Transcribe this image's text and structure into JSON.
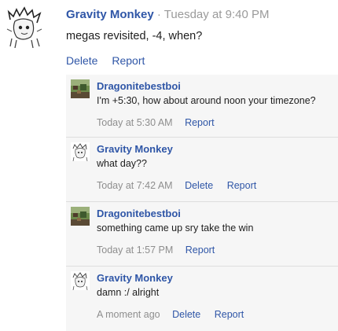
{
  "main_post": {
    "author": "Gravity Monkey",
    "separator": "·",
    "timestamp": "Tuesday at 9:40 PM",
    "body": "megas revisited, -4, when?",
    "actions": {
      "delete": "Delete",
      "report": "Report"
    }
  },
  "replies": [
    {
      "author": "Dragonitebestboi",
      "text": "I'm +5:30, how about around noon your timezone?",
      "time": "Today at 5:30 AM",
      "actions": {
        "report": "Report"
      },
      "avatar_icon": "pixel-landscape-avatar-icon"
    },
    {
      "author": "Gravity Monkey",
      "text": "what day??",
      "time": "Today at 7:42 AM",
      "actions": {
        "delete": "Delete",
        "report": "Report"
      },
      "avatar_icon": "anime-sketch-avatar-icon"
    },
    {
      "author": "Dragonitebestboi",
      "text": "something came up sry take the win",
      "time": "Today at 1:57 PM",
      "actions": {
        "report": "Report"
      },
      "avatar_icon": "pixel-landscape-avatar-icon"
    },
    {
      "author": "Gravity Monkey",
      "text": "damn :/ alright",
      "time": "A moment ago",
      "actions": {
        "delete": "Delete",
        "report": "Report"
      },
      "avatar_icon": "anime-sketch-avatar-icon"
    }
  ],
  "colors": {
    "link": "#2f56a7",
    "muted": "#9a9a9a",
    "reply_background": "#f6f6f6"
  }
}
